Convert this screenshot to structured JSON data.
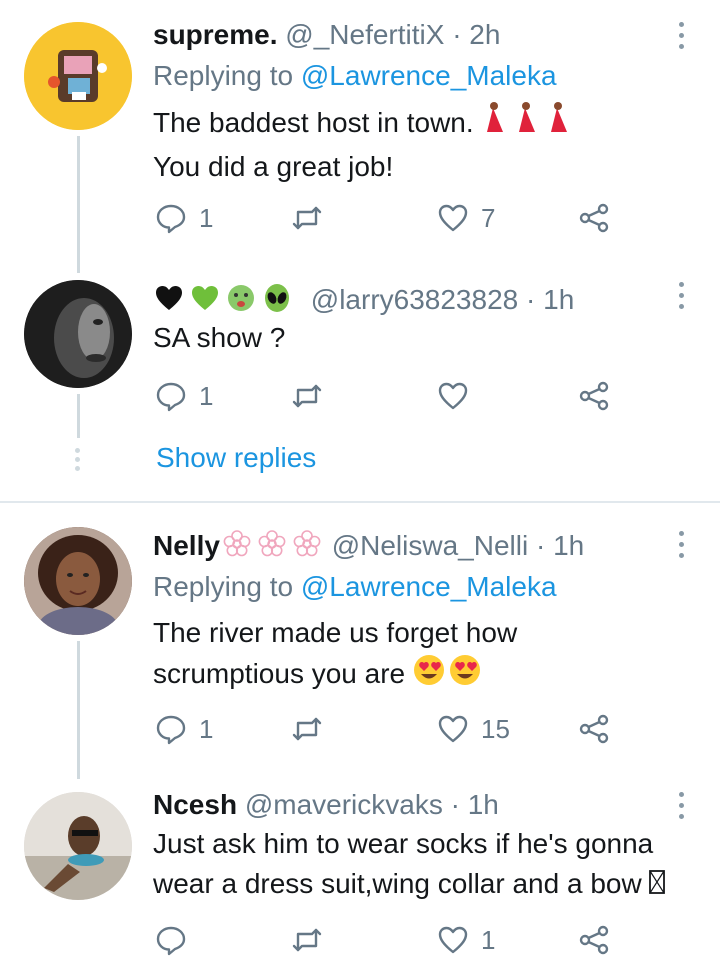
{
  "tweets": [
    {
      "name": "supreme.",
      "handle": "@_NefertitiX",
      "time": "· 2h",
      "replying_prefix": "Replying to ",
      "replying_to": "@Lawrence_Maleka",
      "line1": "The baddest host in town.",
      "line2": "You did a great job!",
      "replies": "1",
      "retweets": "",
      "likes": "7"
    },
    {
      "name": "",
      "handle": "@larry63823828",
      "time": "· 1h",
      "line1": "SA show ?",
      "replies": "1",
      "retweets": "",
      "likes": ""
    },
    {
      "name": "Nelly",
      "handle": "@Neliswa_Nelli",
      "time": "· 1h",
      "replying_prefix": "Replying to ",
      "replying_to": "@Lawrence_Maleka",
      "line1": "The river made us forget how",
      "line2": "scrumptious you are",
      "replies": "1",
      "retweets": "",
      "likes": "15"
    },
    {
      "name": "Ncesh",
      "handle": "@maverickvaks",
      "time": "· 1h",
      "line1": "Just ask him to wear socks if he's gonna",
      "line2": "wear a dress suit,wing collar and a bow",
      "replies": "",
      "retweets": "",
      "likes": "1"
    }
  ],
  "show_replies": "Show replies",
  "colors": {
    "link": "#1b95e0",
    "muted": "#657786",
    "divider": "#e1e8ed"
  }
}
